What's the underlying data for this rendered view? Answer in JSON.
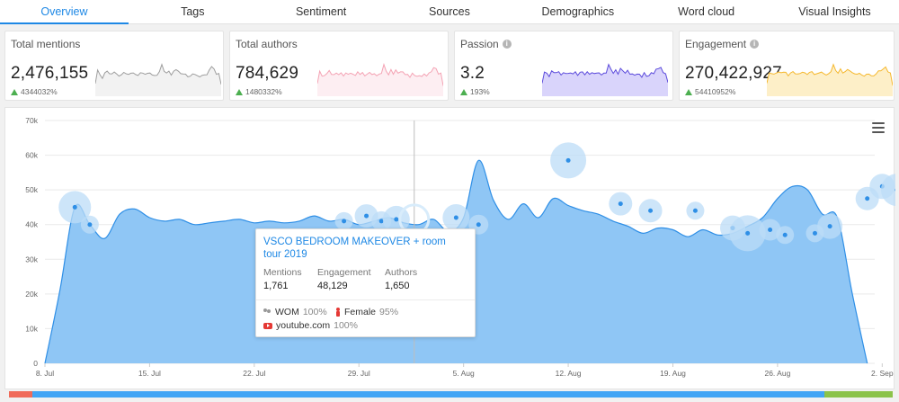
{
  "tabs": [
    {
      "label": "Overview",
      "active": true
    },
    {
      "label": "Tags"
    },
    {
      "label": "Sentiment"
    },
    {
      "label": "Sources"
    },
    {
      "label": "Demographics"
    },
    {
      "label": "Word cloud"
    },
    {
      "label": "Visual Insights"
    }
  ],
  "kpis": [
    {
      "title": "Total mentions",
      "value": "2,476,155",
      "delta": "4344032%",
      "spark_color": "#9e9e9e",
      "spark_fill": "#f2f2f2",
      "has_info": false
    },
    {
      "title": "Total authors",
      "value": "784,629",
      "delta": "1480332%",
      "spark_color": "#f4a3b4",
      "spark_fill": "#fdeef2",
      "has_info": false
    },
    {
      "title": "Passion",
      "value": "3.2",
      "delta": "193%",
      "spark_color": "#5c4bdc",
      "spark_fill": "#d9d4fb",
      "has_info": true
    },
    {
      "title": "Engagement",
      "value": "270,422,927",
      "delta": "54410952%",
      "spark_color": "#f5b82e",
      "spark_fill": "#fdefc8",
      "has_info": true
    }
  ],
  "chart_data": {
    "type": "area",
    "x_ticks": [
      "8. Jul",
      "15. Jul",
      "22. Jul",
      "29. Jul",
      "5. Aug",
      "12. Aug",
      "19. Aug",
      "26. Aug",
      "2. Sep"
    ],
    "y_ticks": [
      "0",
      "10k",
      "20k",
      "30k",
      "40k",
      "50k",
      "60k",
      "70k"
    ],
    "ylim": [
      0,
      70000
    ],
    "series": [
      {
        "color": "#2f8fe6",
        "fill": "#8fc6f5",
        "x_day_index": [
          0,
          1,
          2,
          3,
          4,
          5,
          6,
          7,
          8,
          9,
          10,
          11,
          12,
          13,
          14,
          15,
          16,
          17,
          18,
          19,
          20,
          21,
          22,
          23,
          24,
          25,
          26,
          27,
          28,
          29,
          30,
          31,
          32,
          33,
          34,
          35,
          36,
          37,
          38,
          39,
          40,
          41,
          42,
          43,
          44,
          45,
          46,
          47,
          48,
          49,
          50,
          51,
          52,
          53,
          54,
          55,
          56,
          57,
          58,
          59,
          60,
          61,
          62,
          63
        ],
        "values": [
          0,
          21000,
          45000,
          40000,
          36000,
          43000,
          44500,
          42000,
          41000,
          41500,
          40000,
          40500,
          41000,
          41500,
          40500,
          41000,
          40500,
          41000,
          42500,
          41000,
          41500,
          40000,
          41000,
          42000,
          40500,
          40000,
          41500,
          38000,
          42000,
          58500,
          47000,
          41500,
          46000,
          42000,
          47500,
          45500,
          44000,
          43000,
          41000,
          39500,
          37500,
          39000,
          38500,
          36500,
          38500,
          37000,
          37500,
          39500,
          42000,
          47500,
          51000,
          50000,
          43000,
          42000,
          20000,
          0,
          0,
          0,
          0,
          0,
          0,
          0,
          0,
          0
        ]
      }
    ],
    "bubbles": [
      {
        "day": 2,
        "value": 45000,
        "size": 18
      },
      {
        "day": 3,
        "value": 40000,
        "size": 10
      },
      {
        "day": 20,
        "value": 41000,
        "size": 10
      },
      {
        "day": 21.5,
        "value": 42500,
        "size": 13
      },
      {
        "day": 22.5,
        "value": 41000,
        "size": 11
      },
      {
        "day": 23.5,
        "value": 41500,
        "size": 15
      },
      {
        "day": 27.5,
        "value": 42000,
        "size": 15
      },
      {
        "day": 29,
        "value": 40000,
        "size": 11
      },
      {
        "day": 35,
        "value": 58500,
        "size": 20
      },
      {
        "day": 38.5,
        "value": 46000,
        "size": 13
      },
      {
        "day": 40.5,
        "value": 44000,
        "size": 13
      },
      {
        "day": 43.5,
        "value": 44000,
        "size": 10
      },
      {
        "day": 46,
        "value": 39000,
        "size": 14
      },
      {
        "day": 47,
        "value": 37500,
        "size": 20
      },
      {
        "day": 48.5,
        "value": 38500,
        "size": 12
      },
      {
        "day": 49.5,
        "value": 37000,
        "size": 10
      },
      {
        "day": 51.5,
        "value": 37500,
        "size": 10
      },
      {
        "day": 52.5,
        "value": 39500,
        "size": 14
      },
      {
        "day": 55,
        "value": 47500,
        "size": 13
      },
      {
        "day": 56,
        "value": 51000,
        "size": 14
      },
      {
        "day": 57,
        "value": 50000,
        "size": 18
      },
      {
        "day": 59.5,
        "value": 42000,
        "size": 16
      }
    ],
    "hover_day": 24.7
  },
  "tooltip": {
    "title": "VSCO BEDROOM MAKEOVER + room tour 2019",
    "mentions_label": "Mentions",
    "mentions_value": "1,761",
    "engagement_label": "Engagement",
    "engagement_value": "48,129",
    "authors_label": "Authors",
    "authors_value": "1,650",
    "wom_label": "WOM",
    "wom_pct": "100%",
    "female_label": "Female",
    "female_pct": "95%",
    "source_label": "youtube.com",
    "source_pct": "100%"
  },
  "bottom_bar": [
    {
      "color": "#f06b5a",
      "fraction": 0.026
    },
    {
      "color": "#42a5f5",
      "fraction": 0.897
    },
    {
      "color": "#8bc34a",
      "fraction": 0.077
    }
  ]
}
